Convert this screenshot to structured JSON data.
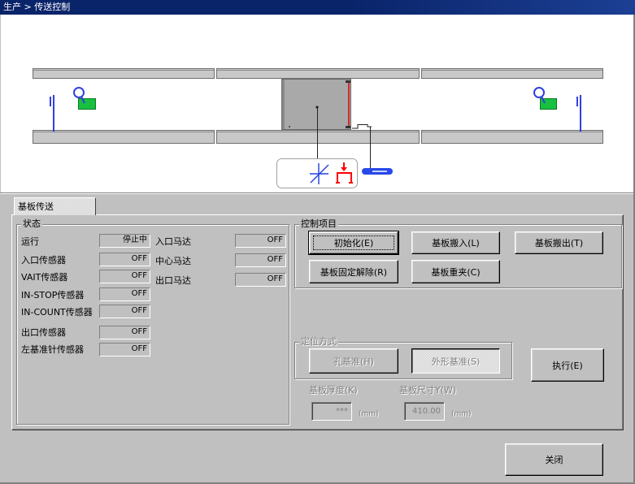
{
  "window": {
    "title": "生产 > 传送控制"
  },
  "colors": {
    "title_bar": "#0a246a",
    "panel": "#c0c0c0",
    "board": "#a9a9a9",
    "stopper": "#3040e0",
    "sensor_indicator": "#18c040",
    "clamp": "#ff0000",
    "board_edge_marker": "#e00000"
  },
  "diagram": {
    "icons": [
      "entry-stopper-icon",
      "entry-sensor-icon",
      "board-icon",
      "support-motor-icon",
      "clamp-icon",
      "board-sensor-icon",
      "exit-sensor-icon",
      "exit-stopper-icon"
    ]
  },
  "tab": {
    "label": "基板传送",
    "selected": true
  },
  "status": {
    "title": "状态",
    "left": [
      {
        "label": "运行",
        "value": "停止中"
      },
      {
        "label": "入口传感器",
        "value": "OFF"
      },
      {
        "label": "VAIT传感器",
        "value": "OFF"
      },
      {
        "label": "IN-STOP传感器",
        "value": "OFF"
      },
      {
        "label": "IN-COUNT传感器",
        "value": "OFF"
      },
      {
        "label": "出口传感器",
        "value": "OFF"
      },
      {
        "label": "左基准针传感器",
        "value": "OFF"
      }
    ],
    "right": [
      {
        "label": "入口马达",
        "value": "OFF"
      },
      {
        "label": "中心马达",
        "value": "OFF"
      },
      {
        "label": "出口马达",
        "value": "OFF"
      }
    ]
  },
  "control": {
    "title": "控制项目",
    "init_label": "初始化(E)",
    "load_label": "基板搬入(L)",
    "unload_label": "基板搬出(T)",
    "release_label": "基板固定解除(R)",
    "reclamp_label": "基板重夹(C)"
  },
  "positioning": {
    "title": "定位方式",
    "enabled": false,
    "hole_label": "孔基准(H)",
    "outline_label": "外形基准(S)",
    "selected": "outline"
  },
  "execute_label": "执行(E)",
  "thickness": {
    "label": "基板厚度(K)",
    "value": "***",
    "unit": "(mm)",
    "enabled": false
  },
  "size_y": {
    "label": "基板尺寸Y(W)",
    "value": "410.00",
    "unit": "(mm)",
    "enabled": false
  },
  "close_label": "关闭"
}
